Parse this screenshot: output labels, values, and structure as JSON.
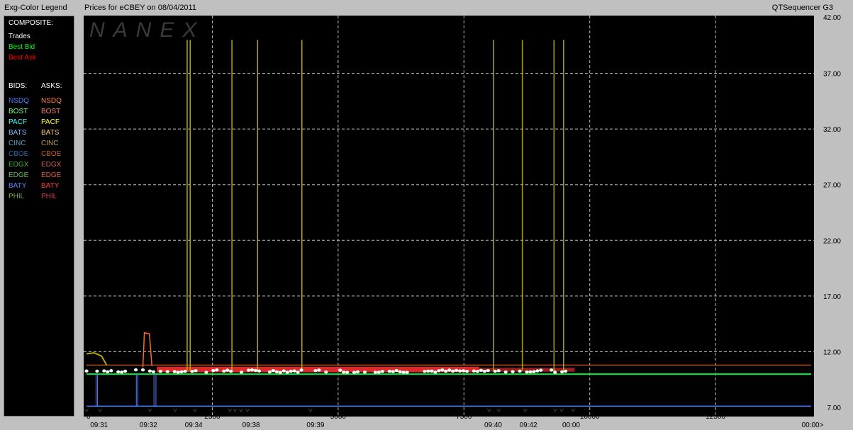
{
  "window": {
    "legend_title": "Exg-Color Legend",
    "chart_title": "Prices for  eCBEY  on  08/04/2011",
    "app_title": "QTSequencer G3"
  },
  "legend": {
    "composite_heading": "COMPOSITE:",
    "composite": [
      {
        "label": "Trades",
        "color": "#ffffff"
      },
      {
        "label": "Best Bid",
        "color": "#00ff00"
      },
      {
        "label": "Best Ask",
        "color": "#ff0000"
      }
    ],
    "bids_heading": "BIDS:",
    "asks_heading": "ASKS:",
    "exchanges": [
      {
        "bid": "NSDQ",
        "ask": "NSDQ",
        "bid_color": "#4f81ff",
        "ask_color": "#ff8040"
      },
      {
        "bid": "BOST",
        "ask": "BOST",
        "bid_color": "#80ff80",
        "ask_color": "#ff8080"
      },
      {
        "bid": "PACF",
        "ask": "PACF",
        "bid_color": "#40ffff",
        "ask_color": "#ffff40"
      },
      {
        "bid": "BATS",
        "ask": "BATS",
        "bid_color": "#80c0ff",
        "ask_color": "#ffd080"
      },
      {
        "bid": "CINC",
        "ask": "CINC",
        "bid_color": "#5fa0c0",
        "ask_color": "#c0a060"
      },
      {
        "bid": "CBOE",
        "ask": "CBOE",
        "bid_color": "#3060a0",
        "ask_color": "#c06020"
      },
      {
        "bid": "EDGX",
        "ask": "EDGX",
        "bid_color": "#40b040",
        "ask_color": "#d06060"
      },
      {
        "bid": "EDGE",
        "ask": "EDGE",
        "bid_color": "#60c060",
        "ask_color": "#e06040"
      },
      {
        "bid": "BATY",
        "ask": "BATY",
        "bid_color": "#6080ff",
        "ask_color": "#ff4040"
      },
      {
        "bid": "PHIL",
        "ask": "PHIL",
        "bid_color": "#80b040",
        "ask_color": "#d04060"
      }
    ]
  },
  "watermark": "NANEX",
  "colors": {
    "trade_spike": "#b8a800",
    "best_bid": "#00ff00",
    "best_ask": "#ff0000",
    "trades": "#ffffff",
    "nsdq_bid": "#4f81ff",
    "cyan_bid": "#00c0c0",
    "ask_blob": "#ff3030",
    "orange_ask": "#ff6a20"
  },
  "chart_data": {
    "type": "line",
    "title": "Prices for  eCBEY  on  08/04/2011",
    "xlim": [
      0,
      14400
    ],
    "ylim": [
      7.0,
      42.0
    ],
    "grid": true,
    "y_ticks": [
      "7.00",
      "12.00",
      "17.00",
      "22.00",
      "27.00",
      "32.00",
      "37.00",
      "42.00"
    ],
    "y_tick_values": [
      7,
      12,
      17,
      22,
      27,
      32,
      37,
      42
    ],
    "x_ticks": [
      "0",
      "2500",
      "5000",
      "7500",
      "10000",
      "12500"
    ],
    "x_tick_values": [
      0,
      2500,
      5000,
      7500,
      10000,
      12500
    ],
    "x_end_label": "00:00>",
    "time_labels": [
      {
        "label": "09:31",
        "x": 250
      },
      {
        "label": "09:32",
        "x": 1230
      },
      {
        "label": "09:34",
        "x": 2130
      },
      {
        "label": "09:38",
        "x": 3270
      },
      {
        "label": "09:39",
        "x": 4550
      },
      {
        "label": "09:40",
        "x": 8080
      },
      {
        "label": "09:42",
        "x": 8780
      },
      {
        "label": "00:00",
        "x": 9630
      }
    ],
    "trade_marker_x": [
      0,
      270,
      1260,
      1760,
      2150,
      2850,
      2950,
      3070,
      3200,
      4450,
      8000,
      8190,
      8720,
      9310,
      9440,
      9670
    ],
    "series": [
      {
        "name": "Trades",
        "spikes": [
          {
            "x": 2000,
            "low": 10.3,
            "high": 40.0
          },
          {
            "x": 2060,
            "low": 10.3,
            "high": 40.0
          },
          {
            "x": 2890,
            "low": 10.2,
            "high": 40.0
          },
          {
            "x": 3400,
            "low": 10.2,
            "high": 40.0
          },
          {
            "x": 4280,
            "low": 10.3,
            "high": 40.0
          },
          {
            "x": 8090,
            "low": 10.3,
            "high": 40.0
          },
          {
            "x": 8660,
            "low": 10.3,
            "high": 40.0
          },
          {
            "x": 9290,
            "low": 10.2,
            "high": 40.0
          },
          {
            "x": 9480,
            "low": 10.3,
            "high": 40.0
          }
        ]
      },
      {
        "name": "Best Bid",
        "x": [
          0,
          9700,
          14400
        ],
        "values": [
          10.0,
          10.0,
          10.0
        ]
      },
      {
        "name": "Best Ask",
        "x": [
          0,
          14400
        ],
        "values": [
          10.8,
          10.8
        ]
      },
      {
        "name": "NSDQ Bid",
        "x": [
          0,
          14400
        ],
        "values": [
          7.1,
          7.1
        ]
      }
    ]
  }
}
